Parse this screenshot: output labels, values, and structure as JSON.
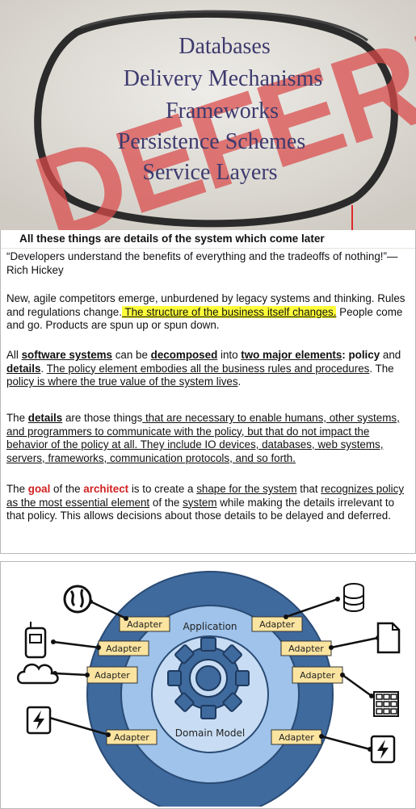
{
  "slide": {
    "items": [
      "Databases",
      "Delivery Mechanisms",
      "Frameworks",
      "Persistence Schemes",
      "Service Layers"
    ],
    "stamp": "DEFER!",
    "caption": "All these things are details of the system which come later"
  },
  "quote": {
    "text": "“Developers understand the benefits of everything and the tradeoffs of nothing!”— Rich Hickey"
  },
  "para1": {
    "a": "New, agile competitors emerge, unburdened by legacy systems and thinking. Rules and regulations change.",
    "b": " The structure of the business itself changes.",
    "c": " People come and go. Products are spun up or spun down."
  },
  "para2": {
    "a": "All ",
    "b": "software systems",
    "c": " can be ",
    "d": "decomposed",
    "e": " into ",
    "f": "two major elements",
    "g": ": policy",
    "h": " and ",
    "i": "details",
    "j": ". ",
    "k": "The policy element embodies all the business rules and procedures",
    "l": ". The ",
    "m": "policy is where the true value of the system lives",
    "n": "."
  },
  "para3": {
    "a": "The ",
    "b": "details",
    "c": " are those things",
    "d": " that are necessary to enable humans, other systems, and programmers to communicate with the policy, but that do not impact the behavior of the policy at all. They include IO devices, databases, web systems, servers, frameworks, communication protocols, and so forth."
  },
  "para4": {
    "a": "The ",
    "b": "goal",
    "c": " of the ",
    "d": "architect",
    "e": " is to create a ",
    "f": "shape for the system",
    "g": " that ",
    "h": "recognizes policy as the most essential element",
    "i": " of the ",
    "j": "system",
    "k": " while making the details irrelevant to that policy. This allows decisions about those details to be delayed and deferred."
  },
  "diagram": {
    "outer_label": "Application",
    "inner_label": "Domain Model",
    "adapter_label": "Adapter",
    "colors": {
      "outer": "#3f6a9e",
      "middle": "#9fc3ea",
      "gear": "#3f6a9e",
      "adapter": "#fbe4a0"
    }
  }
}
